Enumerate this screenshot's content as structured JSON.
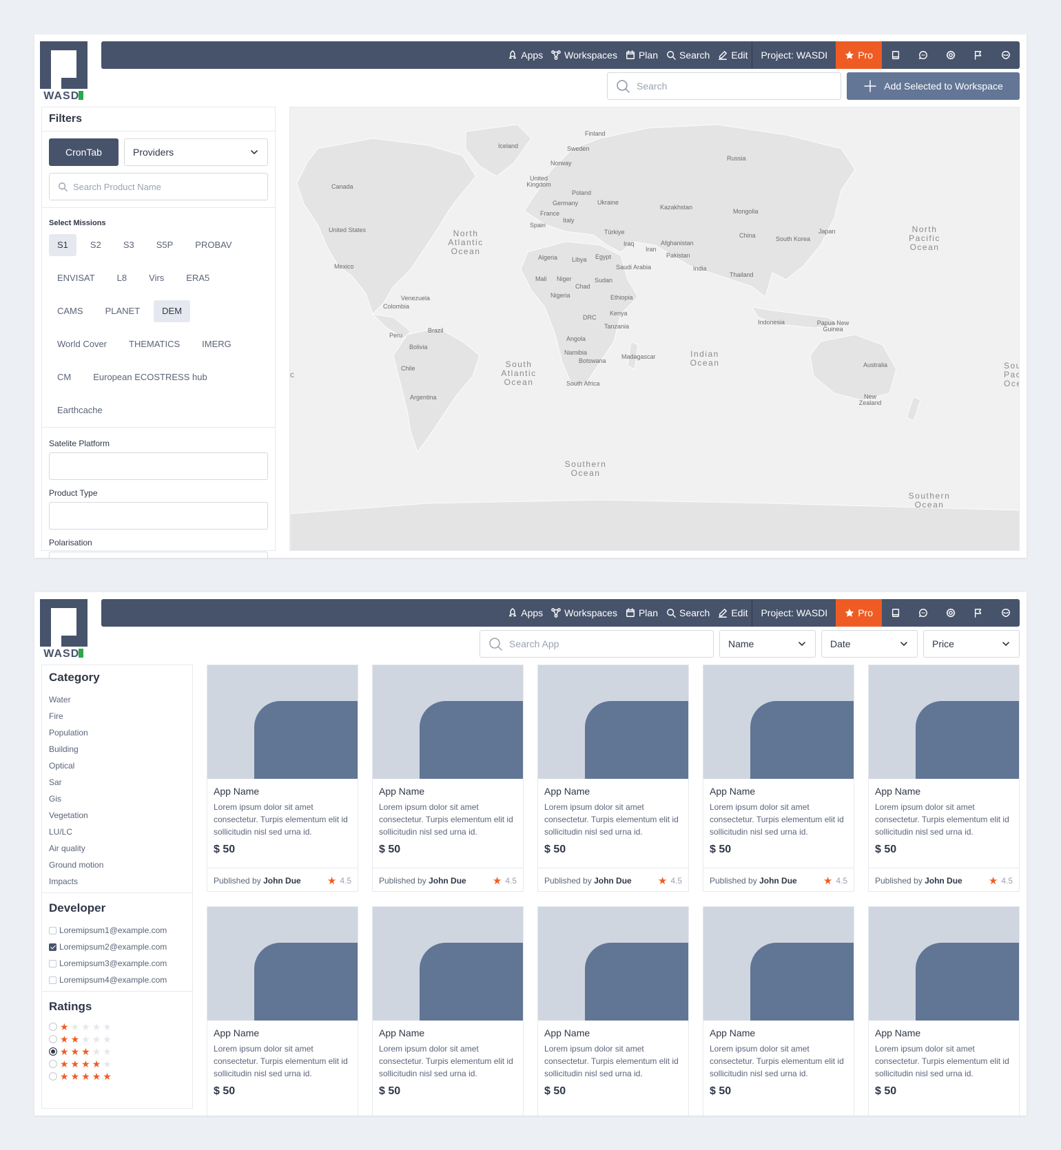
{
  "app": {
    "brand": "WASDI"
  },
  "nav": {
    "apps": "Apps",
    "workspaces": "Workspaces",
    "plan": "Plan",
    "search": "Search",
    "edit": "Edit",
    "project": "Project: WASDI",
    "pro": "Pro"
  },
  "colors": {
    "nav_bg": "#46536b",
    "accent": "#ee5c24",
    "button": "#637696",
    "chip_selected": "#e5e9ef"
  },
  "search_page": {
    "search_placeholder": "Search",
    "add_button": "Add Selected to Workspace",
    "filters_title": "Filters",
    "crontab_button": "CronTab",
    "providers_select": "Providers",
    "product_search_placeholder": "Search Product Name",
    "missions_label": "Select Missions",
    "missions": [
      {
        "label": "S1",
        "selected": true
      },
      {
        "label": "S2",
        "selected": false
      },
      {
        "label": "S3",
        "selected": false
      },
      {
        "label": "S5P",
        "selected": false
      },
      {
        "label": "PROBAV",
        "selected": false
      },
      {
        "label": "ENVISAT",
        "selected": false
      },
      {
        "label": "L8",
        "selected": false
      },
      {
        "label": "Virs",
        "selected": false
      },
      {
        "label": "ERA5",
        "selected": false
      },
      {
        "label": "CAMS",
        "selected": false
      },
      {
        "label": "PLANET",
        "selected": false
      },
      {
        "label": "DEM",
        "selected": true
      },
      {
        "label": "World Cover",
        "selected": false
      },
      {
        "label": "THEMATICS",
        "selected": false
      },
      {
        "label": "IMERG",
        "selected": false
      },
      {
        "label": "CM",
        "selected": false
      },
      {
        "label": "European ECOSTRESS hub",
        "selected": false
      },
      {
        "label": "Earthcache",
        "selected": false
      }
    ],
    "satellite_platform_label": "Satelite Platform",
    "product_type_label": "Product Type",
    "polarisation_label": "Polarisation",
    "map_labels": {
      "finland": "Finland",
      "iceland": "Iceland",
      "sweden": "Sweden",
      "norway": "Norway",
      "russia": "Russia",
      "uk": "United Kingdom",
      "poland": "Poland",
      "canada": "Canada",
      "germany": "Germany",
      "ukraine": "Ukraine",
      "kazakhstan": "Kazakhstan",
      "mongolia": "Mongolia",
      "france": "France",
      "italy": "Italy",
      "spain": "Spain",
      "us": "United States",
      "turkiye": "Türkiye",
      "china": "China",
      "south_korea": "South Korea",
      "japan": "Japan",
      "iraq": "Iraq",
      "iran": "Iran",
      "afghanistan": "Afghanistan",
      "pakistan": "Pakistan",
      "algeria": "Algeria",
      "libya": "Libya",
      "egypt": "Egypt",
      "mexico": "Mexico",
      "saudi": "Saudi Arabia",
      "india": "India",
      "thailand": "Thailand",
      "mali": "Mali",
      "niger": "Niger",
      "chad": "Chad",
      "sudan": "Sudan",
      "nigeria": "Nigeria",
      "ethiopia": "Ethiopia",
      "venezuela": "Venezuela",
      "colombia": "Colombia",
      "kenya": "Kenya",
      "drc": "DRC",
      "tanzania": "Tanzania",
      "indonesia": "Indonesia",
      "png": "Papua New Guinea",
      "peru": "Peru",
      "brazil": "Brazil",
      "angola": "Angola",
      "bolivia": "Bolivia",
      "namibia": "Namibia",
      "botswana": "Botswana",
      "madagascar": "Madagascar",
      "australia": "Australia",
      "chile": "Chile",
      "south_africa": "South Africa",
      "argentina": "Argentina",
      "new_zealand": "New Zealand",
      "north_atlantic": "North Atlantic Ocean",
      "north_pacific": "North Pacific Ocean",
      "south_atlantic": "South Atlantic Ocean",
      "indian_ocean": "Indian Ocean",
      "southern_ocean": "Southern Ocean",
      "southern_ocean_2": "Southern Ocean",
      "south_pacific": "South Pacific Ocean",
      "c": "c"
    }
  },
  "marketplace": {
    "search_placeholder": "Search App",
    "sort_name": "Name",
    "sort_date": "Date",
    "sort_price": "Price",
    "category_title": "Category",
    "categories": [
      "Water",
      "Fire",
      "Population",
      "Building",
      "Optical",
      "Sar",
      "Gis",
      "Vegetation",
      "LU/LC",
      "Air quality",
      "Ground motion",
      "Impacts"
    ],
    "developer_title": "Developer",
    "developers": [
      {
        "email": "Loremipsum1@example.com",
        "checked": false
      },
      {
        "email": "Loremipsum2@example.com",
        "checked": true
      },
      {
        "email": "Loremipsum3@example.com",
        "checked": false
      },
      {
        "email": "Loremipsum4@example.com",
        "checked": false
      }
    ],
    "ratings_title": "Ratings",
    "ratings": [
      {
        "stars": 1,
        "selected": false
      },
      {
        "stars": 2,
        "selected": false
      },
      {
        "stars": 3,
        "selected": true
      },
      {
        "stars": 4,
        "selected": false
      },
      {
        "stars": 5,
        "selected": false
      }
    ],
    "cards": [
      {
        "name": "App Name",
        "desc": "Lorem ipsum dolor sit amet consectetur. Turpis elementum elit id sollicitudin nisl sed urna id.",
        "price": "$ 50",
        "published_by": "Published by",
        "author": "John Due",
        "rating": "4.5"
      },
      {
        "name": "App Name",
        "desc": "Lorem ipsum dolor sit amet consectetur. Turpis elementum elit id sollicitudin nisl sed urna id.",
        "price": "$ 50",
        "published_by": "Published by",
        "author": "John Due",
        "rating": "4.5"
      },
      {
        "name": "App Name",
        "desc": "Lorem ipsum dolor sit amet consectetur. Turpis elementum elit id sollicitudin nisl sed urna id.",
        "price": "$ 50",
        "published_by": "Published by",
        "author": "John Due",
        "rating": "4.5"
      },
      {
        "name": "App Name",
        "desc": "Lorem ipsum dolor sit amet consectetur. Turpis elementum elit id sollicitudin nisl sed urna id.",
        "price": "$ 50",
        "published_by": "Published by",
        "author": "John Due",
        "rating": "4.5"
      },
      {
        "name": "App Name",
        "desc": "Lorem ipsum dolor sit amet consectetur. Turpis elementum elit id sollicitudin nisl sed urna id.",
        "price": "$ 50",
        "published_by": "Published by",
        "author": "John Due",
        "rating": "4.5"
      },
      {
        "name": "App Name",
        "desc": "Lorem ipsum dolor sit amet consectetur. Turpis elementum elit id sollicitudin nisl sed urna id.",
        "price": "$ 50"
      },
      {
        "name": "App Name",
        "desc": "Lorem ipsum dolor sit amet consectetur. Turpis elementum elit id sollicitudin nisl sed urna id.",
        "price": "$ 50"
      },
      {
        "name": "App Name",
        "desc": "Lorem ipsum dolor sit amet consectetur. Turpis elementum elit id sollicitudin nisl sed urna id.",
        "price": "$ 50"
      },
      {
        "name": "App Name",
        "desc": "Lorem ipsum dolor sit amet consectetur. Turpis elementum elit id sollicitudin nisl sed urna id.",
        "price": "$ 50"
      },
      {
        "name": "App Name",
        "desc": "Lorem ipsum dolor sit amet consectetur. Turpis elementum elit id sollicitudin nisl sed urna id.",
        "price": "$ 50"
      }
    ]
  }
}
